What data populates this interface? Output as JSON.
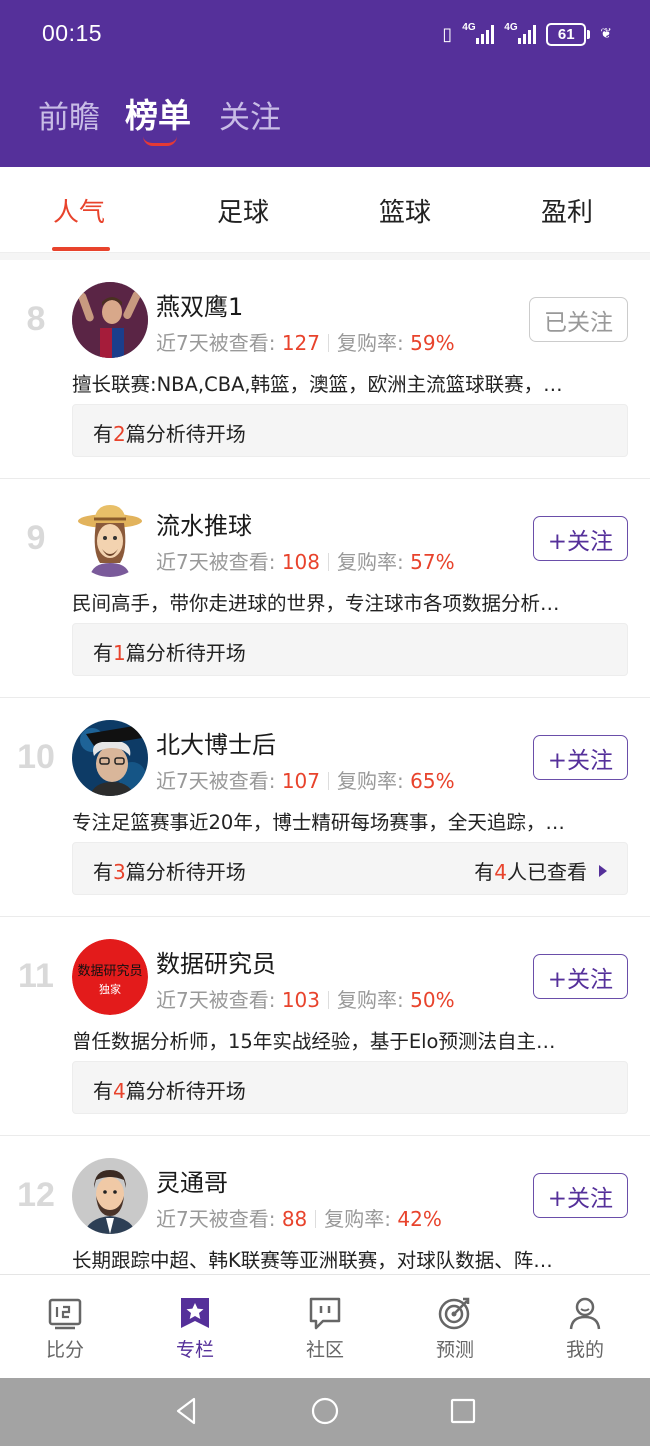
{
  "status_bar": {
    "time": "00:15",
    "network_1": "4G",
    "network_2": "4G",
    "battery": "61"
  },
  "top_tabs": [
    {
      "label": "前瞻",
      "active": false
    },
    {
      "label": "榜单",
      "active": true
    },
    {
      "label": "关注",
      "active": false
    }
  ],
  "sub_tabs": [
    {
      "label": "人气",
      "active": true
    },
    {
      "label": "足球",
      "active": false
    },
    {
      "label": "篮球",
      "active": false
    },
    {
      "label": "盈利",
      "active": false
    }
  ],
  "list": {
    "views_label": "近7天被查看:",
    "repurchase_label": "复购率:",
    "pending_prefix": "有",
    "pending_suffix": "篇分析待开场",
    "items": [
      {
        "rank": "8",
        "name": "燕双鹰1",
        "views": "127",
        "repurchase": "59%",
        "follow_label": "已关注",
        "followed": true,
        "desc": "擅长联赛:NBA,CBA,韩篮，澳篮，欧洲主流篮球联赛，…",
        "pending_count": "2",
        "avatar_icon": "player-avatar-icon"
      },
      {
        "rank": "9",
        "name": "流水推球",
        "views": "108",
        "repurchase": "57%",
        "follow_label": "+关注",
        "followed": false,
        "desc": "民间高手，带你走进球的世界，专注球市各项数据分析…",
        "pending_count": "1",
        "avatar_icon": "cartoon-hat-avatar-icon"
      },
      {
        "rank": "10",
        "name": "北大博士后",
        "views": "107",
        "repurchase": "65%",
        "follow_label": "+关注",
        "followed": false,
        "desc": "专注足篮赛事近20年，博士精研每场赛事，全天追踪，…",
        "pending_count": "3",
        "viewed_prefix": "有",
        "viewed_count": "4",
        "viewed_suffix": "人已查看",
        "avatar_icon": "scientist-avatar-icon"
      },
      {
        "rank": "11",
        "name": "数据研究员",
        "views": "103",
        "repurchase": "50%",
        "follow_label": "+关注",
        "followed": false,
        "desc": "曾任数据分析师，15年实战经验，基于Elo预测法自主…",
        "pending_count": "4",
        "avatar_icon": "data-logo-avatar-icon",
        "avatar_text_1": "数据研究员",
        "avatar_text_2": "独家"
      },
      {
        "rank": "12",
        "name": "灵通哥",
        "views": "88",
        "repurchase": "42%",
        "follow_label": "+关注",
        "followed": false,
        "desc": "长期跟踪中超、韩K联赛等亚洲联赛，对球队数据、阵…",
        "avatar_icon": "bearded-man-avatar-icon"
      }
    ]
  },
  "bottom_nav": [
    {
      "label": "比分",
      "icon": "scoreboard-icon",
      "active": false
    },
    {
      "label": "专栏",
      "icon": "star-bookmark-icon",
      "active": true
    },
    {
      "label": "社区",
      "icon": "chat-bubble-icon",
      "active": false
    },
    {
      "label": "预测",
      "icon": "target-icon",
      "active": false
    },
    {
      "label": "我的",
      "icon": "user-icon",
      "active": false
    }
  ],
  "colors": {
    "brand_purple": "#55309a",
    "accent_red": "#e8432c"
  }
}
